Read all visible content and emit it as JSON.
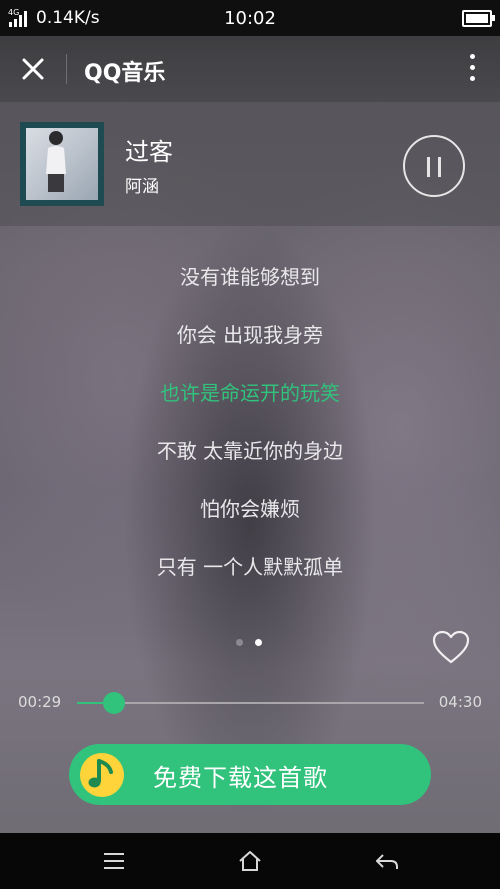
{
  "status_bar": {
    "network_label": "4G",
    "net_speed": "0.14K/s",
    "time": "10:02"
  },
  "header": {
    "close_icon": "close-icon",
    "title": "QQ音乐",
    "more_icon": "more-vertical-icon"
  },
  "now_playing": {
    "title": "过客",
    "artist": "阿涵",
    "state_icon": "pause-icon"
  },
  "lyrics": [
    {
      "text": "没有谁能够想到",
      "active": false
    },
    {
      "text": "你会 出现我身旁",
      "active": false
    },
    {
      "text": "也许是命运开的玩笑",
      "active": true
    },
    {
      "text": "不敢 太靠近你的身边",
      "active": false
    },
    {
      "text": "怕你会嫌烦",
      "active": false
    },
    {
      "text": "只有 一个人默默孤单",
      "active": false
    }
  ],
  "pager": {
    "count": 2,
    "active_index": 1
  },
  "progress": {
    "current": "00:29",
    "total": "04:30",
    "fraction": 0.107
  },
  "download_button": {
    "label": "免费下载这首歌",
    "icon": "music-note-icon"
  },
  "nav": {
    "menu_icon": "menu-icon",
    "home_icon": "home-icon",
    "back_icon": "back-icon"
  },
  "colors": {
    "accent": "#31c27c",
    "lyric_text": "#e8e8ea",
    "icon_outline": "#e6e6e6"
  }
}
